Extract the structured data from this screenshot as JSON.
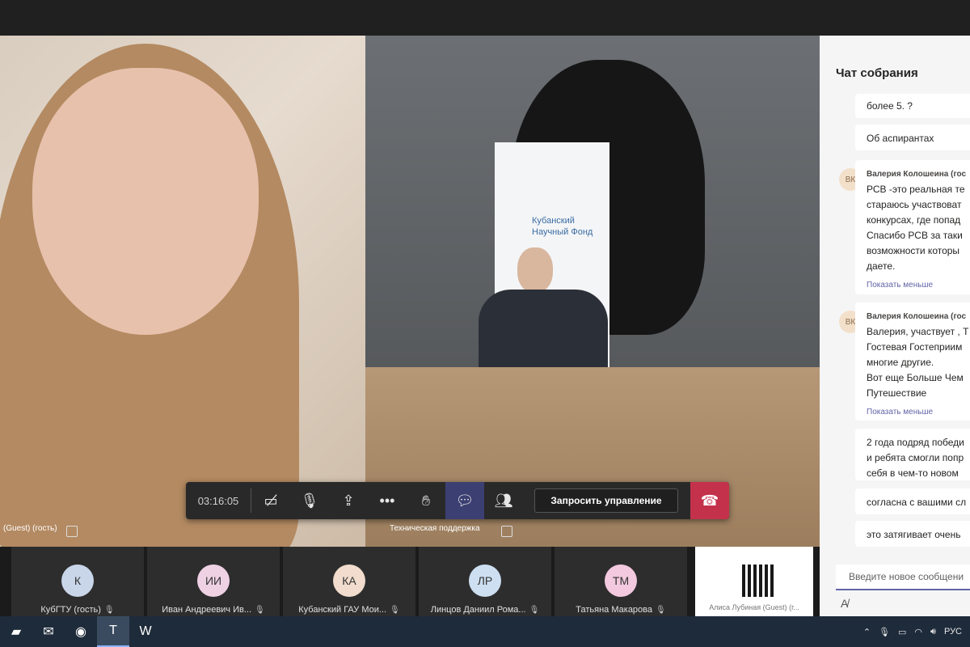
{
  "call": {
    "timer": "03:16:05",
    "request_control_label": "Запросить управление"
  },
  "videos": {
    "left_label": "(Guest) (гость)",
    "right_label": "Техническая поддержка",
    "banner_text": "Кубанский Научный Фонд"
  },
  "participants": [
    {
      "initials": "К",
      "name": "КубГТУ (гость)",
      "color": "#c9d6ea"
    },
    {
      "initials": "ИИ",
      "name": "Иван Андреевич Ив...",
      "color": "#efd1e4"
    },
    {
      "initials": "КА",
      "name": "Кубанский ГАУ Мои...",
      "color": "#f1dccd"
    },
    {
      "initials": "ЛР",
      "name": "Линцов Даниил Рома...",
      "color": "#cddff1"
    },
    {
      "initials": "ТМ",
      "name": "Татьяна Макарова",
      "color": "#f2c9de"
    }
  ],
  "screen_share_label": "Алиса Лубиная (Guest) (г...",
  "chat": {
    "title": "Чат собрания",
    "messages": [
      {
        "text": "более 5. ?"
      },
      {
        "text": "Об аспирантах"
      },
      {
        "avatar": "ВК",
        "author": "Валерия Колошеина (гос",
        "lines": [
          "РСВ -это реальная те",
          "стараюсь участвоват",
          "конкурсах, где попад",
          "Спасибо РСВ за таки",
          "возможности которы",
          "даете."
        ],
        "show_less": "Показать меньше"
      },
      {
        "avatar": "ВК",
        "author": "Валерия Колошеина (гос",
        "lines": [
          "Валерия, участвует , Т",
          "Гостевая Гостеприим",
          "многие другие.",
          "Вот еще Больше Чем",
          "Путешествие"
        ],
        "show_less": "Показать меньше"
      },
      {
        "lines": [
          "2 года подряд победи",
          "и ребята смогли попр",
          "себя в чем-то новом"
        ]
      },
      {
        "text": "согласна с вашими сл"
      },
      {
        "text": "это затягивает очень"
      }
    ],
    "input_placeholder": "Введите новое сообщени"
  },
  "taskbar": {
    "lang": "РУС"
  }
}
